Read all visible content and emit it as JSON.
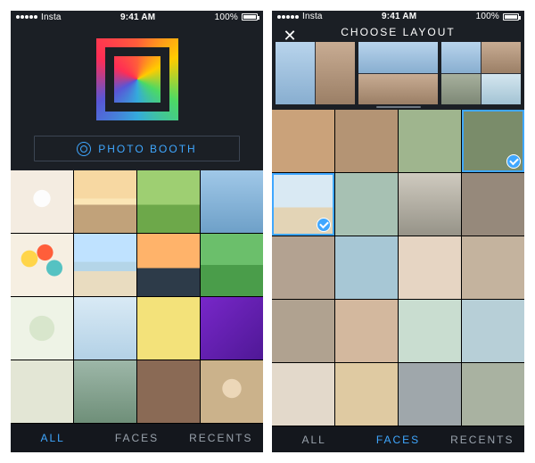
{
  "status": {
    "carrier_back": "Insta",
    "time": "9:41 AM",
    "battery_pct": "100%"
  },
  "screen1": {
    "photobooth_label": "PHOTO BOOTH",
    "tabs": {
      "all": "ALL",
      "faces": "FACES",
      "recents": "RECENTS",
      "active": "all"
    }
  },
  "screen2": {
    "title": "CHOOSE LAYOUT",
    "tabs": {
      "all": "ALL",
      "faces": "FACES",
      "recents": "RECENTS",
      "active": "faces"
    },
    "selected_indices": [
      3,
      4
    ]
  }
}
